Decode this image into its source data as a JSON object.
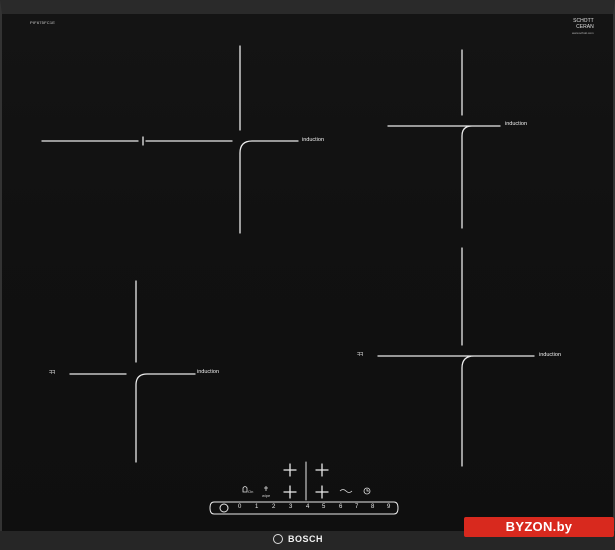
{
  "model_code": "PIF675FC1E",
  "schott": {
    "line1": "SCHOTT",
    "line2": "CERAN",
    "line3": "www.schott.com"
  },
  "zones": {
    "front_left_label": "induction",
    "rear_left_label": "induction",
    "rear_right_label": "induction",
    "front_right_label": "induction"
  },
  "controls": {
    "boost_left": "ᖷᖷ",
    "boost_right": "ᖷᖷ",
    "main_switch_icon": "power-icon",
    "scale": [
      "0",
      "1",
      "2",
      "3",
      "4",
      "5",
      "6",
      "7",
      "8",
      "9"
    ],
    "childlock_label": "On",
    "wipe_label": "wipe",
    "timer_icon": "clock-icon"
  },
  "brand": "BOSCH",
  "watermark": "BYZON.by"
}
